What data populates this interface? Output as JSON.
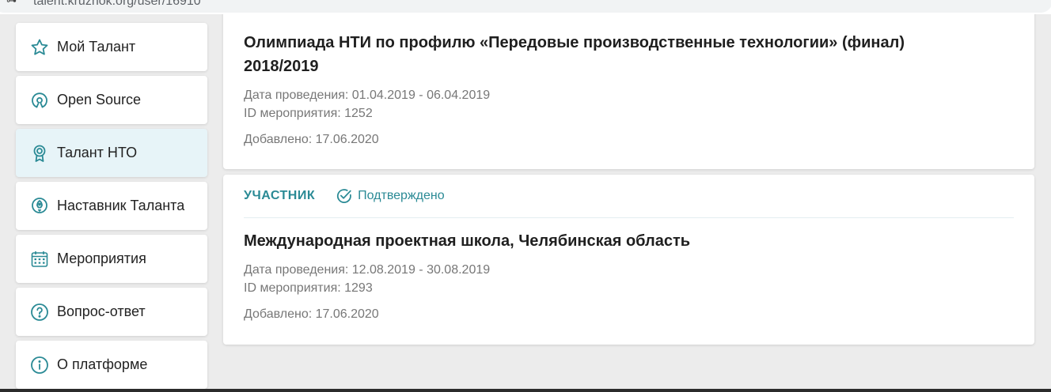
{
  "browser": {
    "url": "talent.kruzhok.org/user/16910"
  },
  "sidebar": {
    "items": [
      {
        "label": "Мой Талант",
        "icon": "star-icon",
        "active": false
      },
      {
        "label": "Open Source",
        "icon": "open-source-icon",
        "active": false
      },
      {
        "label": "Талант НТО",
        "icon": "award-icon",
        "active": true
      },
      {
        "label": "Наставник Таланта",
        "icon": "rocket-icon",
        "active": false
      },
      {
        "label": "Мероприятия",
        "icon": "calendar-icon",
        "active": false
      },
      {
        "label": "Вопрос-ответ",
        "icon": "question-icon",
        "active": false
      },
      {
        "label": "О платформе",
        "icon": "info-icon",
        "active": false
      }
    ]
  },
  "events": [
    {
      "title_line1": "Олимпиада НТИ по профилю «Передовые производственные технологии» (финал)",
      "title_line2": "2018/2019",
      "dates": "Дата проведения: 01.04.2019 - 06.04.2019",
      "event_id": "ID мероприятия: 1252",
      "added": "Добавлено: 17.06.2020"
    },
    {
      "role": "УЧАСТНИК",
      "status": "Подтверждено",
      "title": "Международная проектная школа, Челябинская область",
      "dates": "Дата проведения: 12.08.2019 - 30.08.2019",
      "event_id": "ID мероприятия: 1293",
      "added": "Добавлено: 17.06.2020"
    }
  ],
  "colors": {
    "accent": "#2a8a95",
    "active_bg": "#e7f4f8"
  }
}
